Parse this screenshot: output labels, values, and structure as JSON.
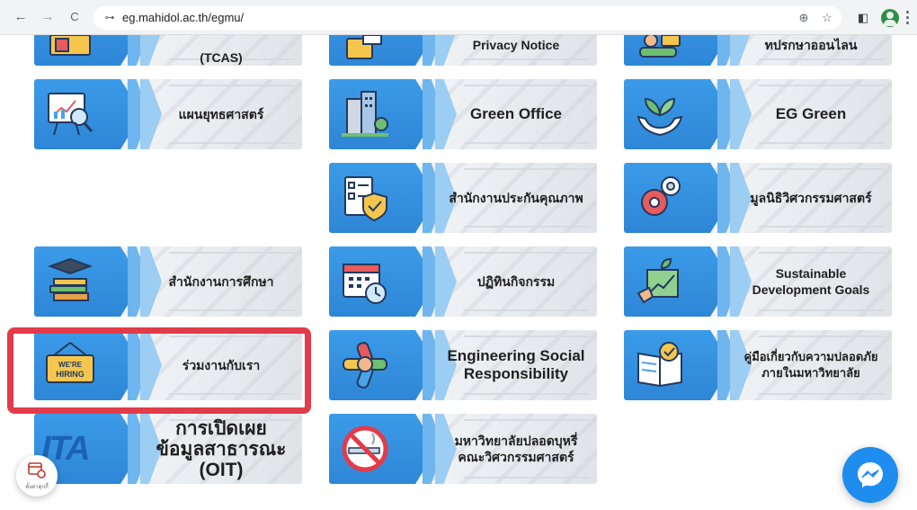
{
  "browser": {
    "back_icon": "←",
    "forward_icon": "→",
    "reload_icon": "C",
    "site_info_icon": "⊶",
    "url": "eg.mahidol.ac.th/egmu/",
    "zoom_icon": "⊕",
    "star_icon": "☆",
    "sidepanel_icon": "◧"
  },
  "tiles": {
    "tcas": "(TCAS)",
    "privacy": "Privacy Notice",
    "consult": "ทปรกษาออนไลน",
    "strategy": "แผนยุทธศาสตร์",
    "green_office": "Green Office",
    "eg_green": "EG Green",
    "qa": "สำนักงานประกันคุณภาพ",
    "foundation": "มูลนิธิวิศวกรรมศาสตร์",
    "education": "สำนักงานการศึกษา",
    "calendar": "ปฏิทินกิจกรรม",
    "sdg": "Sustainable Development Goals",
    "hiring": "ร่วมงานกับเรา",
    "hiring_sign": "WE'RE HIRING",
    "esr": "Engineering Social Responsibility",
    "safety": "คู่มือเกี่ยวกับความปลอดภัย ภายในมหาวิทยาลัย",
    "oit_line1": "การเปิดเผย",
    "oit_line2": "ข้อมูลสาธารณะ",
    "oit_line3": "(OIT)",
    "ita": "ITA",
    "nosmoke_line1": "มหาวิทยาลัยปลอดบุหรี่",
    "nosmoke_line2": "คณะวิศวกรรมศาสตร์"
  },
  "floating_widget": {
    "caption": "ตั้งค่าคุกกี้"
  },
  "colors": {
    "accent_blue": "#2e86d6",
    "highlight_red": "#e23b4a",
    "messenger_blue": "#1f8cf0"
  }
}
